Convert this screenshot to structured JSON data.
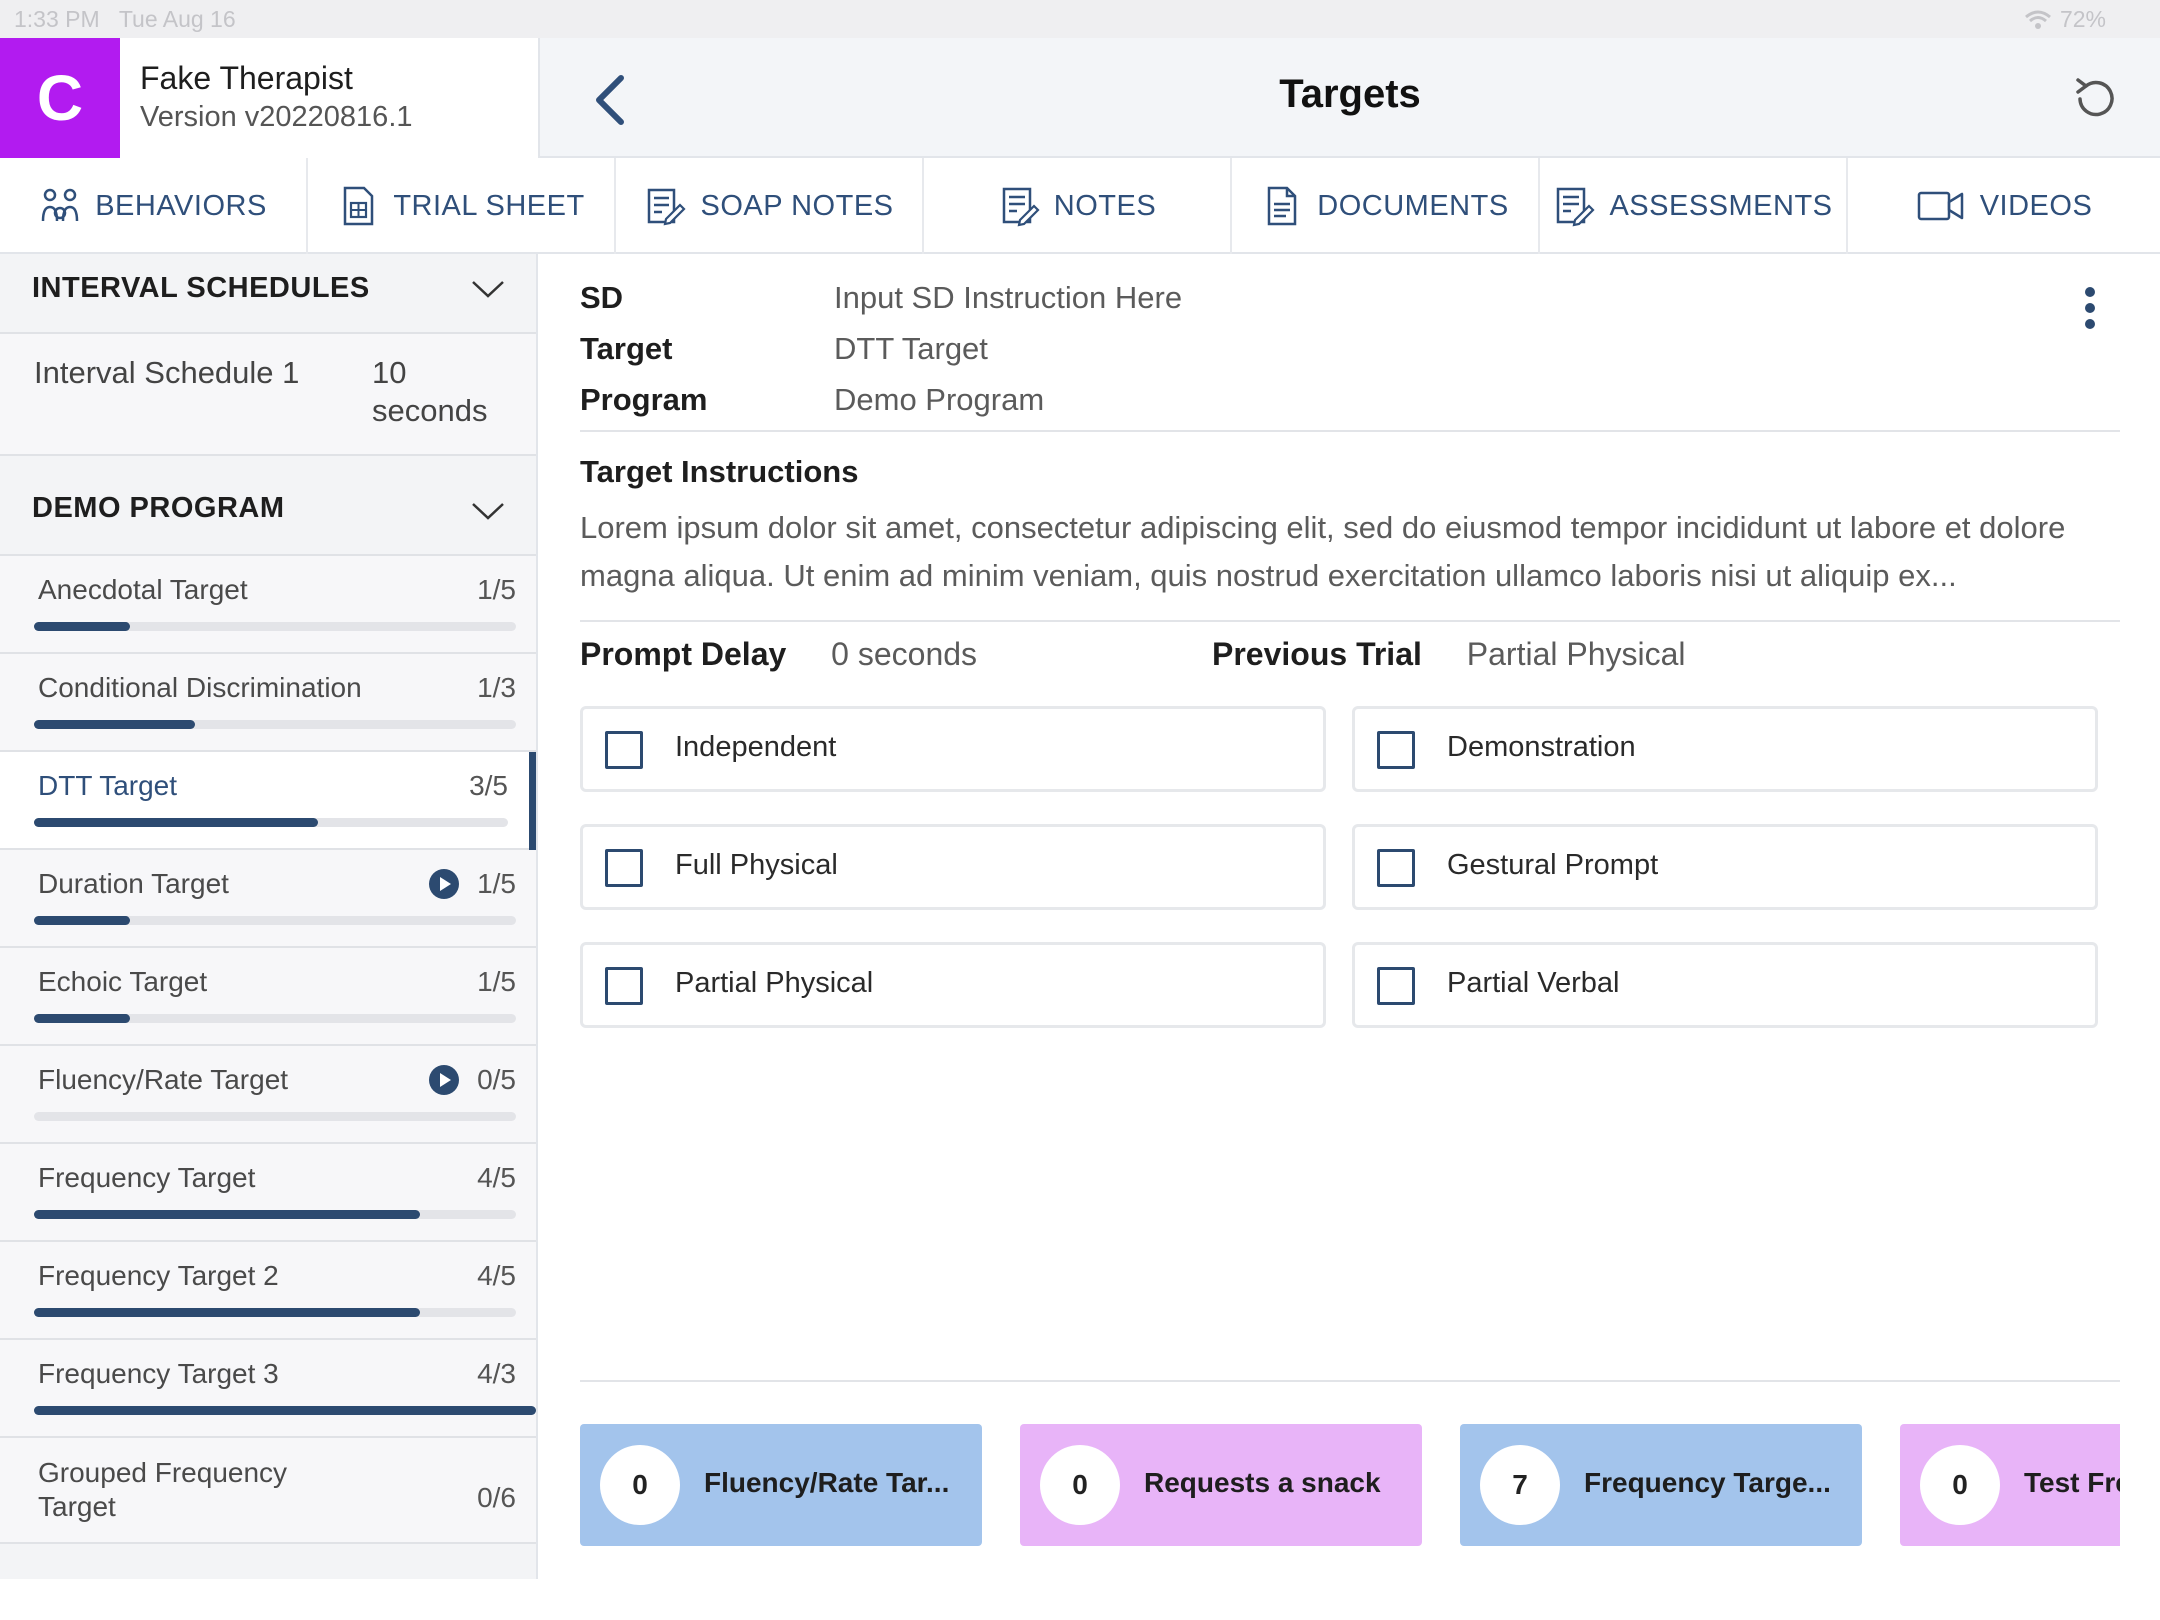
{
  "status_bar": {
    "time": "1:33 PM",
    "date": "Tue Aug 16",
    "battery": "72%"
  },
  "header": {
    "avatar_letter": "C",
    "user_name": "Fake Therapist",
    "version": "Version v20220816.1",
    "title": "Targets"
  },
  "tabs": [
    {
      "label": "BEHAVIORS",
      "icon": "behaviors-icon"
    },
    {
      "label": "TRIAL SHEET",
      "icon": "trial-sheet-icon"
    },
    {
      "label": "SOAP NOTES",
      "icon": "soap-notes-icon"
    },
    {
      "label": "NOTES",
      "icon": "notes-icon"
    },
    {
      "label": "DOCUMENTS",
      "icon": "documents-icon"
    },
    {
      "label": "ASSESSMENTS",
      "icon": "assessments-icon"
    },
    {
      "label": "VIDEOS",
      "icon": "video-camera-icon"
    }
  ],
  "sidebar": {
    "interval_section": {
      "title": "INTERVAL SCHEDULES",
      "items": [
        {
          "name": "Interval Schedule 1",
          "value": "10 seconds"
        }
      ]
    },
    "program_section": {
      "title": "DEMO PROGRAM",
      "targets": [
        {
          "name": "Anecdotal Target",
          "count": "1/5",
          "progress": 0.2,
          "play": false,
          "active": false
        },
        {
          "name": "Conditional Discrimination",
          "count": "1/3",
          "progress": 0.333,
          "play": false,
          "active": false
        },
        {
          "name": "DTT Target",
          "count": "3/5",
          "progress": 0.6,
          "play": false,
          "active": true
        },
        {
          "name": "Duration Target",
          "count": "1/5",
          "progress": 0.2,
          "play": true,
          "active": false
        },
        {
          "name": "Echoic Target",
          "count": "1/5",
          "progress": 0.2,
          "play": false,
          "active": false
        },
        {
          "name": "Fluency/Rate Target",
          "count": "0/5",
          "progress": 0,
          "play": true,
          "active": false
        },
        {
          "name": "Frequency Target",
          "count": "4/5",
          "progress": 0.8,
          "play": false,
          "active": false
        },
        {
          "name": "Frequency Target 2",
          "count": "4/5",
          "progress": 0.8,
          "play": false,
          "active": false
        },
        {
          "name": "Frequency Target 3",
          "count": "4/3",
          "progress": 1.0,
          "play": false,
          "active": false
        },
        {
          "name": "Grouped Frequency Target",
          "count": "0/6",
          "progress": 0,
          "play": false,
          "active": false
        }
      ]
    }
  },
  "main": {
    "sd_label": "SD",
    "sd_value": "Input SD Instruction Here",
    "target_label": "Target",
    "target_value": "DTT Target",
    "program_label": "Program",
    "program_value": "Demo Program",
    "instructions_title": "Target Instructions",
    "instructions_text": "Lorem ipsum dolor sit amet, consectetur adipiscing elit, sed do eiusmod tempor incididunt ut labore et dolore magna aliqua. Ut enim ad minim veniam, quis nostrud exercitation ullamco laboris nisi ut aliquip ex...",
    "prompt_delay_label": "Prompt Delay",
    "prompt_delay_value": "0 seconds",
    "previous_trial_label": "Previous Trial",
    "previous_trial_value": "Partial Physical",
    "prompts": [
      "Independent",
      "Demonstration",
      "Full Physical",
      "Gestural Prompt",
      "Partial Physical",
      "Partial Verbal"
    ],
    "counters": [
      {
        "count": "0",
        "label": "Fluency/Rate Tar...",
        "color": "#a3c4ec"
      },
      {
        "count": "0",
        "label": "Requests a snack",
        "color": "#e8b4f8"
      },
      {
        "count": "7",
        "label": "Frequency Targe...",
        "color": "#a3c4ec"
      },
      {
        "count": "0",
        "label": "Test Frequency",
        "color": "#e8b4f8"
      }
    ]
  },
  "colors": {
    "accent": "#2c4a70",
    "avatar": "#b21bf0",
    "chip_blue": "#a3c4ec",
    "chip_pink": "#e8b4f8"
  }
}
